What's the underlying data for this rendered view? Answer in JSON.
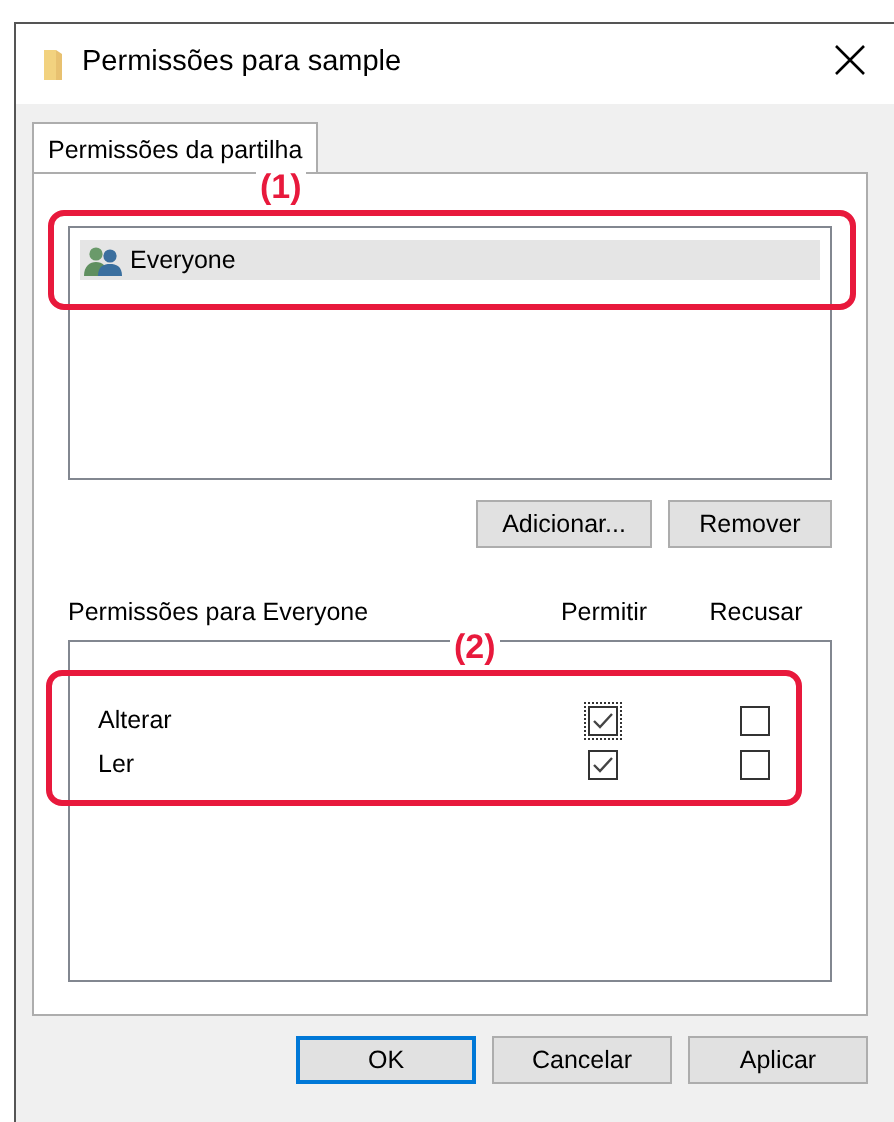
{
  "window": {
    "title": "Permissões para sample"
  },
  "tabs": [
    {
      "label": "Permissões da partilha",
      "selected": true
    }
  ],
  "principals": [
    {
      "name": "Everyone",
      "selected": true
    }
  ],
  "principal_buttons": [
    "Adicionar...",
    "Remover"
  ],
  "permissions": {
    "heading": "Permissões para Everyone",
    "columns": [
      "Permitir",
      "Recusar"
    ],
    "rows": [
      {
        "name": "Alterar",
        "allow": true,
        "deny": false,
        "focused": true
      },
      {
        "name": "Ler",
        "allow": true,
        "deny": false,
        "focused": false
      }
    ]
  },
  "dialog_buttons": [
    {
      "label": "OK",
      "default": true
    },
    {
      "label": "Cancelar",
      "default": false
    },
    {
      "label": "Aplicar",
      "default": false
    }
  ],
  "callouts": [
    {
      "label": "(1)"
    },
    {
      "label": "(2)"
    }
  ]
}
